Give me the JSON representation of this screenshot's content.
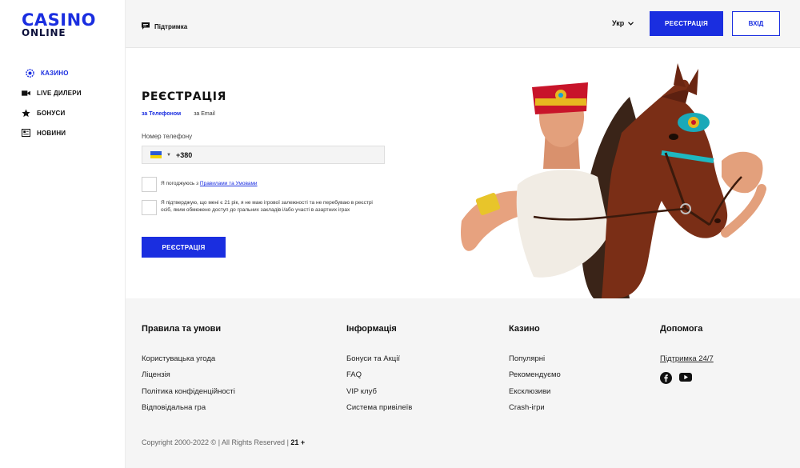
{
  "logo": {
    "line1": "CASINO",
    "line2": "ONLINE"
  },
  "sidebar": {
    "items": [
      {
        "label": "казино",
        "icon": "casino-chip-icon",
        "active": true
      },
      {
        "label": "live дилери",
        "icon": "video-camera-icon",
        "active": false
      },
      {
        "label": "бонуси",
        "icon": "star-icon",
        "active": false
      },
      {
        "label": "новини",
        "icon": "newspaper-icon",
        "active": false
      }
    ]
  },
  "header": {
    "support_label": "Підтримка",
    "support_icon": "chat-icon",
    "lang": "Укр",
    "register_label": "РЕЄСТРАЦІЯ",
    "login_label": "ВХІД"
  },
  "registration": {
    "title": "РЕЄСТРАЦІЯ",
    "tab_phone": "за Телефоном",
    "tab_email": "за Email",
    "phone_label": "Номер телефону",
    "phone_prefix": "+380",
    "agree_text": "Я погоджуюсь з ",
    "agree_link": "Правилами та Умовами",
    "confirm_text": "Я підтверджую, що мені є 21 рік, я не маю ігрової залежності та не перебуваю в реєстрі осіб, яким обмежено доступ до гральних закладів і/або участі в азартних іграх",
    "submit_label": "РЕЄСТРАЦІЯ"
  },
  "footer": {
    "columns": [
      {
        "title": "Правила та умови",
        "links": [
          "Користувацька угода",
          "Ліцензія",
          "Політика конфіденційності",
          "Відповідальна гра"
        ]
      },
      {
        "title": "Інформація",
        "links": [
          "Бонуси та Акції",
          "FAQ",
          "VIP клуб",
          "Система привілеїв"
        ]
      },
      {
        "title": "Казино",
        "links": [
          "Популярні",
          "Рекомендуємо",
          "Ексклюзиви",
          "Crash-ігри"
        ]
      },
      {
        "title": "Допомога",
        "links": [
          "Підтримка 24/7"
        ]
      }
    ],
    "copyright": "Copyright 2000-2022 © | All Rights Reserved | ",
    "age": "21 +"
  },
  "colors": {
    "accent": "#1a2ee0",
    "footer_bg": "#f5f5f5",
    "header_bg": "#f5f5f5"
  }
}
